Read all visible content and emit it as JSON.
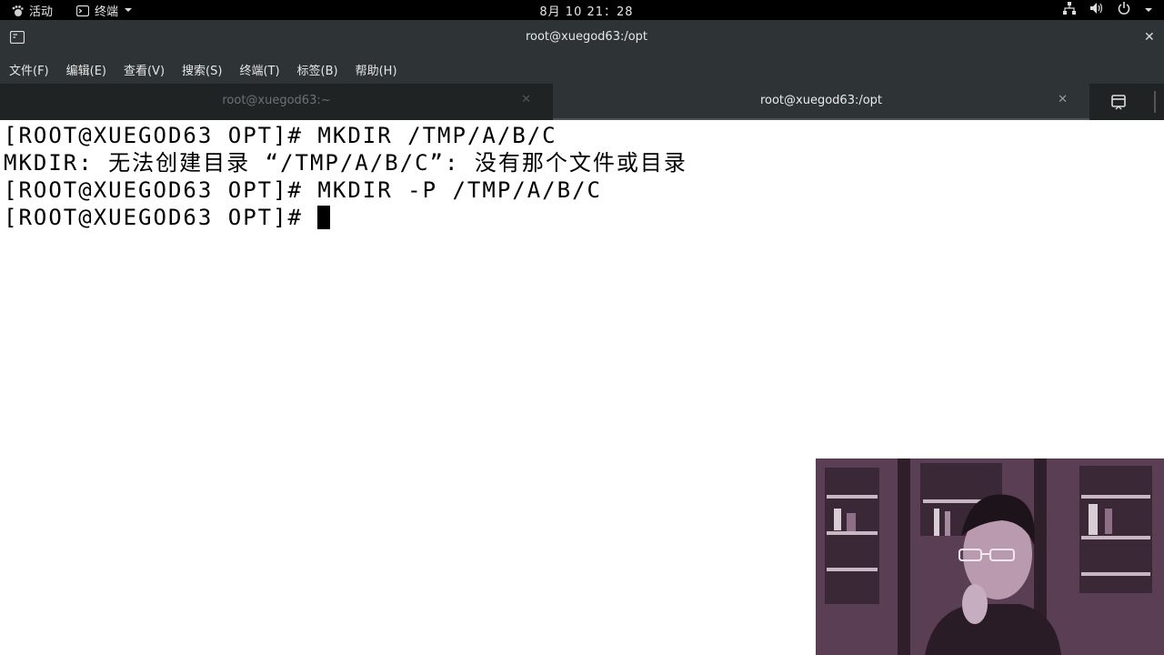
{
  "topbar": {
    "activities_label": "活动",
    "app_label": "终端",
    "clock": "8月 10  21：28"
  },
  "window": {
    "title": "root@xuegod63:/opt"
  },
  "menu": [
    {
      "label": "文件(F)"
    },
    {
      "label": "编辑(E)"
    },
    {
      "label": "查看(V)"
    },
    {
      "label": "搜索(S)"
    },
    {
      "label": "终端(T)"
    },
    {
      "label": "标签(B)"
    },
    {
      "label": "帮助(H)"
    }
  ],
  "tabs": [
    {
      "label": "root@xuegod63:~",
      "active": false
    },
    {
      "label": "root@xuegod63:/opt",
      "active": true
    }
  ],
  "terminal": {
    "lines": [
      "[ROOT@XUEGOD63 OPT]# MKDIR /TMP/A/B/C",
      "MKDIR: 无法创建目录 “/TMP/A/B/C”: 没有那个文件或目录",
      "[ROOT@XUEGOD63 OPT]# MKDIR -P /TMP/A/B/C",
      "[ROOT@XUEGOD63 OPT]# "
    ]
  },
  "icons": {
    "activities": "gnome-foot-icon",
    "terminal_app": "terminal-icon",
    "network": "network-icon",
    "volume": "volume-icon",
    "power": "power-icon",
    "new_window": "new-window-icon",
    "close": "close-icon"
  },
  "colors": {
    "header_bg": "#2e3436",
    "topbar_bg": "#000000",
    "terminal_bg": "#ffffff",
    "terminal_fg": "#000000"
  }
}
